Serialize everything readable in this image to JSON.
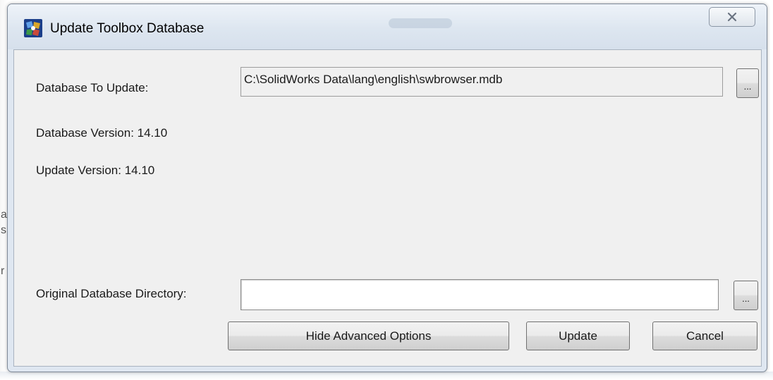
{
  "window": {
    "title": "Update Toolbox Database",
    "icon": "solidworks-toolbox-icon",
    "close_icon": "close-icon"
  },
  "form": {
    "database_to_update": {
      "label": "Database To Update:",
      "value": "C:\\SolidWorks Data\\lang\\english\\swbrowser.mdb",
      "browse_label": "..."
    },
    "database_version": "Database Version: 14.10",
    "update_version": "Update Version: 14.10",
    "original_directory": {
      "label": "Original Database Directory:",
      "value": "",
      "browse_label": "..."
    }
  },
  "buttons": {
    "hide_advanced": "Hide Advanced Options",
    "update": "Update",
    "cancel": "Cancel"
  },
  "colors": {
    "frame": "#dfe7f1",
    "client": "#f0f0f0",
    "border": "#7f8a99"
  }
}
